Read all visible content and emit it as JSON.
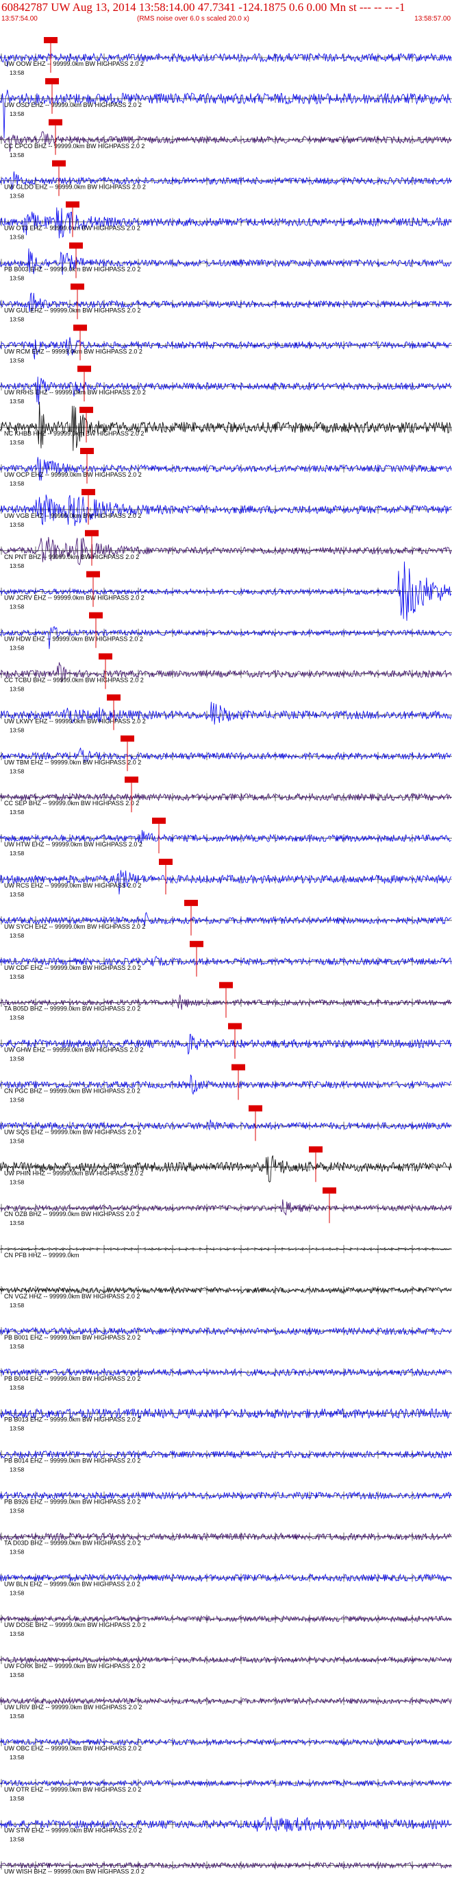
{
  "header": {
    "title": "60842787 UW Aug 13, 2014 13:58:14.00   47.7341 -124.1875  0.6 0.00 Mn st --- -- --  -1",
    "left_time": "13:57:54.00",
    "note": "(RMS noise over 6.0 s scaled 20.0 x)",
    "right_time": "13:58:57.00"
  },
  "colors": {
    "blue": "#0000ee",
    "black": "#000000",
    "purple": "#3a0a6a",
    "red": "#dd0000",
    "grid": "#000000"
  },
  "chart_data": {
    "type": "seismogram",
    "time_range": [
      "13:57:54.00",
      "13:58:57.00"
    ],
    "minute_label": "13:58",
    "trace_suffix": "-- 99999.0km BW  HIGHPASS  2.0  2",
    "traces": [
      {
        "label": "UW OOW EHZ -- 99999.0km BW  HIGHPASS  2.0  2",
        "color": "blue",
        "pick": 0.2,
        "amp": 6,
        "events": [
          {
            "t": 0.2,
            "a": 60,
            "d": 0.02
          },
          {
            "t": 0.8,
            "a": 70,
            "d": 0.03
          }
        ]
      },
      {
        "label": "UW OSD EHZ -- 99999.0km BW  HIGHPASS  2.0  2",
        "color": "blue",
        "pick": 0.4,
        "amp": 8,
        "events": [
          {
            "t": 0.4,
            "a": 50,
            "d": 0.03
          },
          {
            "t": 0.8,
            "a": 55,
            "d": 0.04
          }
        ]
      },
      {
        "label": "CC CPCO BHZ -- 99999.0km BW  HIGHPASS  2.0  2",
        "color": "purple",
        "pick": 0.9,
        "amp": 5,
        "events": [
          {
            "t": 1.1,
            "a": 18,
            "d": 0.6
          },
          {
            "t": 6.1,
            "a": 10,
            "d": 0.8
          }
        ]
      },
      {
        "label": "UW GLDO EHZ -- 99999.0km BW  HIGHPASS  2.0  2",
        "color": "blue",
        "pick": 1.4,
        "amp": 5,
        "events": [
          {
            "t": 1.6,
            "a": 12,
            "d": 0.8
          }
        ]
      },
      {
        "label": "UW OT3 EHZ -- 99999.0km BW  HIGHPASS  2.0  2",
        "color": "blue",
        "pick": 3.4,
        "amp": 6,
        "events": [
          {
            "t": 3.6,
            "a": 18,
            "d": 1.5
          },
          {
            "t": 8.6,
            "a": 20,
            "d": 2.5
          }
        ]
      },
      {
        "label": "PB B003 EHZ -- 99999.0km BW  HIGHPASS  2.0  2",
        "color": "blue",
        "pick": 3.9,
        "amp": 5,
        "events": [
          {
            "t": 4.1,
            "a": 20,
            "d": 1.2
          },
          {
            "t": 9.1,
            "a": 14,
            "d": 1.5
          }
        ]
      },
      {
        "label": "UW GUL EHZ -- 99999.0km BW  HIGHPASS  2.0  2",
        "color": "blue",
        "pick": 4.1,
        "amp": 5,
        "events": [
          {
            "t": 4.3,
            "a": 22,
            "d": 0.8
          }
        ]
      },
      {
        "label": "UW RCM EHZ -- 99999.0km BW  HIGHPASS  2.0  2",
        "color": "blue",
        "pick": 4.5,
        "amp": 5,
        "events": [
          {
            "t": 4.7,
            "a": 26,
            "d": 0.5
          },
          {
            "t": 9.7,
            "a": 22,
            "d": 0.8
          }
        ]
      },
      {
        "label": "UW RRHS EHZ -- 99999.0km BW  HIGHPASS  2.0  2",
        "color": "blue",
        "pick": 5.1,
        "amp": 5,
        "events": [
          {
            "t": 5.3,
            "a": 28,
            "d": 0.7
          },
          {
            "t": 10.3,
            "a": 20,
            "d": 0.9
          }
        ]
      },
      {
        "label": "NC KHBB HHZ -- 99999.0km BW  HIGHPASS  2.0  2",
        "color": "black",
        "pick": 5.4,
        "amp": 8,
        "events": [
          {
            "t": 5.6,
            "a": 34,
            "d": 0.8
          },
          {
            "t": 10.6,
            "a": 30,
            "d": 1.3
          }
        ]
      },
      {
        "label": "UW OCP EHZ -- 99999.0km BW  HIGHPASS  2.0  2",
        "color": "blue",
        "pick": 5.5,
        "amp": 5,
        "events": [
          {
            "t": 5.7,
            "a": 14,
            "d": 2.2
          }
        ]
      },
      {
        "label": "UW VGB EHZ -- 99999.0km BW  HIGHPASS  2.0  2",
        "color": "blue",
        "pick": 5.7,
        "amp": 6,
        "events": [
          {
            "t": 5.9,
            "a": 20,
            "d": 3.2
          },
          {
            "t": 10.9,
            "a": 16,
            "d": 4
          }
        ]
      },
      {
        "label": "CN PNT BHZ -- 99999.0km BW  HIGHPASS  2.0  2",
        "color": "purple",
        "pick": 6.2,
        "amp": 5,
        "events": [
          {
            "t": 6.4,
            "a": 18,
            "d": 2.8
          },
          {
            "t": 11.4,
            "a": 14,
            "d": 3
          }
        ]
      },
      {
        "label": "UW JCRV EHZ -- 99999.0km BW  HIGHPASS  2.0  2",
        "color": "blue",
        "pick": 6.4,
        "amp": 4,
        "events": [
          {
            "t": 59,
            "a": 42,
            "d": 3.5
          }
        ]
      },
      {
        "label": "UW HDW EHZ -- 99999.0km BW  HIGHPASS  2.0  2",
        "color": "blue",
        "pick": 6.8,
        "amp": 4,
        "events": [
          {
            "t": 7,
            "a": 24,
            "d": 0.6
          }
        ]
      },
      {
        "label": "CC TCBU BHZ -- 99999.0km BW  HIGHPASS  2.0  2",
        "color": "purple",
        "pick": 8.2,
        "amp": 5,
        "events": [
          {
            "t": 8.4,
            "a": 16,
            "d": 0.8
          }
        ]
      },
      {
        "label": "UW LKWY EHZ -- 99999.0km BW  HIGHPASS  2.0  2",
        "color": "blue",
        "pick": 9.4,
        "amp": 6,
        "events": [
          {
            "t": 9.6,
            "a": 10,
            "d": 1.5
          },
          {
            "t": 14.6,
            "a": 8,
            "d": 2
          },
          {
            "t": 31,
            "a": 18,
            "d": 1.4
          }
        ]
      },
      {
        "label": "UW TBM EHZ -- 99999.0km BW  HIGHPASS  2.0  2",
        "color": "blue",
        "pick": 11.4,
        "amp": 5,
        "events": [
          {
            "t": 11.6,
            "a": 8,
            "d": 1
          }
        ]
      },
      {
        "label": "CC SEP BHZ -- 99999.0km BW  HIGHPASS  2.0  2",
        "color": "purple",
        "pick": 12,
        "amp": 5,
        "events": []
      },
      {
        "label": "UW HTW EHZ -- 99999.0km BW  HIGHPASS  2.0  2",
        "color": "blue",
        "pick": 16,
        "amp": 5,
        "events": [
          {
            "t": 20,
            "a": 12,
            "d": 1.2
          }
        ]
      },
      {
        "label": "UW RCS EHZ -- 99999.0km BW  HIGHPASS  2.0  2",
        "color": "blue",
        "pick": 17,
        "amp": 6,
        "events": [
          {
            "t": 17.2,
            "a": 22,
            "d": 1
          }
        ]
      },
      {
        "label": "UW SYCH EHZ -- 99999.0km BW  HIGHPASS  2.0  2",
        "color": "blue",
        "pick": 20.7,
        "amp": 5,
        "events": [
          {
            "t": 20.9,
            "a": 10,
            "d": 0.8
          }
        ]
      },
      {
        "label": "UW CDF EHZ -- 99999.0km BW  HIGHPASS  2.0  2",
        "color": "blue",
        "pick": 21.5,
        "amp": 5,
        "events": [
          {
            "t": 21.7,
            "a": 8,
            "d": 0.8
          }
        ]
      },
      {
        "label": "TA B05D BHZ -- 99999.0km BW  HIGHPASS  2.0  2",
        "color": "purple",
        "pick": 25.8,
        "amp": 4,
        "events": [
          {
            "t": 26,
            "a": 12,
            "d": 0.8
          }
        ]
      },
      {
        "label": "UW GHW EHZ -- 99999.0km BW  HIGHPASS  2.0  2",
        "color": "blue",
        "pick": 27.1,
        "amp": 6,
        "events": [
          {
            "t": 27.3,
            "a": 16,
            "d": 0.8
          }
        ]
      },
      {
        "label": "CN PGC BHZ -- 99999.0km BW  HIGHPASS  2.0  2",
        "color": "blue",
        "pick": 27.6,
        "amp": 5,
        "events": [
          {
            "t": 27.8,
            "a": 12,
            "d": 0.8
          }
        ]
      },
      {
        "label": "UW SQS EHZ -- 99999.0km BW  HIGHPASS  2.0  2",
        "color": "blue",
        "pick": 30.1,
        "amp": 5,
        "events": [
          {
            "t": 30.3,
            "a": 10,
            "d": 0.8
          }
        ]
      },
      {
        "label": "UW PHIN HHZ -- 99999.0km BW  HIGHPASS  2.0  2",
        "color": "black",
        "pick": 38.9,
        "amp": 7,
        "events": [
          {
            "t": 39.1,
            "a": 16,
            "d": 1.5
          }
        ]
      },
      {
        "label": "CN OZB BHZ -- 99999.0km BW  HIGHPASS  2.0  2",
        "color": "purple",
        "pick": 40.9,
        "amp": 4,
        "events": [
          {
            "t": 41.1,
            "a": 10,
            "d": 1.5
          }
        ]
      },
      {
        "label": "CN PFB HHZ -- 99999.0km",
        "color": "black",
        "pick": null,
        "amp": 1,
        "events": []
      },
      {
        "label": "CN VGZ HHZ -- 99999.0km BW  HIGHPASS  2.0  2",
        "color": "black",
        "pick": null,
        "amp": 4,
        "events": []
      },
      {
        "label": "PB B001 EHZ -- 99999.0km BW  HIGHPASS  2.0  2",
        "color": "blue",
        "pick": null,
        "amp": 5,
        "events": []
      },
      {
        "label": "PB B004 EHZ -- 99999.0km BW  HIGHPASS  2.0  2",
        "color": "blue",
        "pick": null,
        "amp": 5,
        "events": []
      },
      {
        "label": "PB B013 EHZ -- 99999.0km BW  HIGHPASS  2.0  2",
        "color": "blue",
        "pick": null,
        "amp": 7,
        "events": []
      },
      {
        "label": "PB B014 EHZ -- 99999.0km BW  HIGHPASS  2.0  2",
        "color": "blue",
        "pick": null,
        "amp": 5,
        "events": []
      },
      {
        "label": "PB B926 EHZ -- 99999.0km BW  HIGHPASS  2.0  2",
        "color": "blue",
        "pick": null,
        "amp": 5,
        "events": []
      },
      {
        "label": "TA D03D BHZ -- 99999.0km BW  HIGHPASS  2.0  2",
        "color": "purple",
        "pick": null,
        "amp": 5,
        "events": []
      },
      {
        "label": "UW BLN EHZ -- 99999.0km BW  HIGHPASS  2.0  2",
        "color": "blue",
        "pick": null,
        "amp": 5,
        "events": []
      },
      {
        "label": "UW DOSE BHZ -- 99999.0km BW  HIGHPASS  2.0  2",
        "color": "purple",
        "pick": null,
        "amp": 4,
        "events": []
      },
      {
        "label": "UW FORK BHZ -- 99999.0km BW  HIGHPASS  2.0  2",
        "color": "purple",
        "pick": null,
        "amp": 4,
        "events": []
      },
      {
        "label": "UW LRIV BHZ -- 99999.0km BW  HIGHPASS  2.0  2",
        "color": "purple",
        "pick": null,
        "amp": 4,
        "events": []
      },
      {
        "label": "UW OBC EHZ -- 99999.0km BW  HIGHPASS  2.0  2",
        "color": "blue",
        "pick": null,
        "amp": 4,
        "events": []
      },
      {
        "label": "UW OTR EHZ -- 99999.0km BW  HIGHPASS  2.0  2",
        "color": "blue",
        "pick": null,
        "amp": 4,
        "events": []
      },
      {
        "label": "UW STW EHZ -- 99999.0km BW  HIGHPASS  2.0  2",
        "color": "blue",
        "pick": null,
        "amp": 6,
        "events": [
          {
            "t": 40,
            "a": 6,
            "d": 10
          }
        ]
      },
      {
        "label": "UW WISH BHZ -- 99999.0km BW  HIGHPASS  2.0  2",
        "color": "purple",
        "pick": null,
        "amp": 4,
        "events": []
      }
    ]
  }
}
